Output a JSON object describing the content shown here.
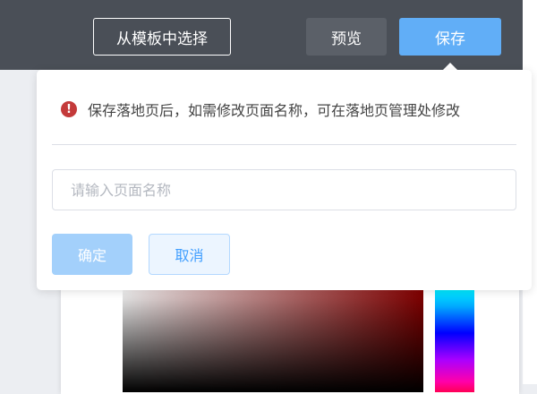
{
  "header": {
    "select_template_label": "从模板中选择",
    "preview_label": "预览",
    "save_label": "保存"
  },
  "save_popover": {
    "warning_icon": "!",
    "message": "保存落地页后，如需修改页面名称，可在落地页管理处修改",
    "name_input": {
      "value": "",
      "placeholder": "请输入页面名称"
    },
    "confirm_label": "确定",
    "cancel_label": "取消"
  },
  "colors": {
    "topbar": "#4a4f57",
    "save_button": "#61aef7",
    "confirm_button_disabled": "#a3d0fb",
    "warning": "#c43a3a"
  }
}
